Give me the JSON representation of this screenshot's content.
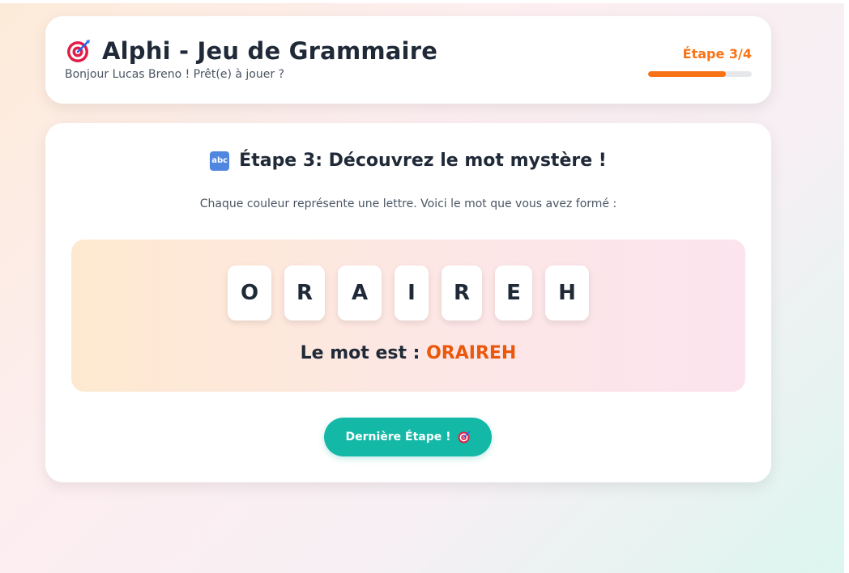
{
  "header": {
    "title": "Alphi - Jeu de Grammaire",
    "greeting": "Bonjour Lucas Breno ! Prêt(e) à jouer ?",
    "step_label": "Étape 3/4",
    "progress_fraction": 0.75,
    "icon": "target-icon"
  },
  "step": {
    "icon": "abc-icon",
    "icon_text": "abc",
    "title": "Étape 3: Découvrez le mot mystère !",
    "instruction": "Chaque couleur représente une lettre. Voici le mot que vous avez formé :",
    "letters": [
      "O",
      "R",
      "A",
      "I",
      "R",
      "E",
      "H"
    ],
    "word_prefix": "Le mot est : ",
    "word": "ORAIREH"
  },
  "actions": {
    "next_label": "Dernière Étape !",
    "next_icon": "target-icon"
  },
  "colors": {
    "accent_orange": "#f97316",
    "word_orange": "#ea580c",
    "button_teal": "#14b8a6"
  }
}
